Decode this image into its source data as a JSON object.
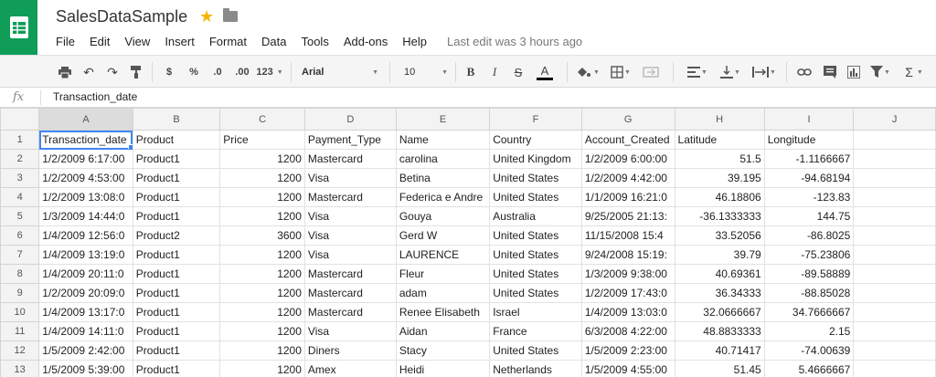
{
  "app": {
    "doc_title": "SalesDataSample",
    "menu": [
      "File",
      "Edit",
      "View",
      "Insert",
      "Format",
      "Data",
      "Tools",
      "Add-ons",
      "Help"
    ],
    "last_edit": "Last edit was 3 hours ago"
  },
  "toolbar": {
    "currency": "$",
    "percent": "%",
    "dec_decrease": ".0",
    "dec_increase": ".00",
    "more_formats": "123",
    "font": "Arial",
    "font_size": "10",
    "bold": "B",
    "italic": "I",
    "strike": "S",
    "text_color": "A",
    "sum": "Σ"
  },
  "formula_bar": {
    "fx": "fx",
    "content": "Transaction_date"
  },
  "sheet": {
    "columns": [
      "A",
      "B",
      "C",
      "D",
      "E",
      "F",
      "G",
      "H",
      "I",
      "J"
    ],
    "rows": [
      {
        "n": "1",
        "cells": [
          "Transaction_date",
          "Product",
          "Price",
          "Payment_Type",
          "Name",
          "Country",
          "Account_Created",
          "Latitude",
          "Longitude",
          ""
        ]
      },
      {
        "n": "2",
        "cells": [
          "1/2/2009 6:17:00",
          "Product1",
          "1200",
          "Mastercard",
          "carolina",
          "United Kingdom",
          "1/2/2009 6:00:00",
          "51.5",
          "-1.1166667",
          ""
        ]
      },
      {
        "n": "3",
        "cells": [
          "1/2/2009 4:53:00",
          "Product1",
          "1200",
          "Visa",
          "Betina",
          "United States",
          "1/2/2009 4:42:00",
          "39.195",
          "-94.68194",
          ""
        ]
      },
      {
        "n": "4",
        "cells": [
          "1/2/2009 13:08:0",
          "Product1",
          "1200",
          "Mastercard",
          "Federica e Andre",
          "United States",
          "1/1/2009 16:21:0",
          "46.18806",
          "-123.83",
          ""
        ]
      },
      {
        "n": "5",
        "cells": [
          "1/3/2009 14:44:0",
          "Product1",
          "1200",
          "Visa",
          "Gouya",
          "Australia",
          "9/25/2005 21:13:",
          "-36.1333333",
          "144.75",
          ""
        ]
      },
      {
        "n": "6",
        "cells": [
          "1/4/2009 12:56:0",
          "Product2",
          "3600",
          "Visa",
          "Gerd W",
          "United States",
          "11/15/2008 15:4",
          "33.52056",
          "-86.8025",
          ""
        ]
      },
      {
        "n": "7",
        "cells": [
          "1/4/2009 13:19:0",
          "Product1",
          "1200",
          "Visa",
          "LAURENCE",
          "United States",
          "9/24/2008 15:19:",
          "39.79",
          "-75.23806",
          ""
        ]
      },
      {
        "n": "8",
        "cells": [
          "1/4/2009 20:11:0",
          "Product1",
          "1200",
          "Mastercard",
          "Fleur",
          "United States",
          "1/3/2009 9:38:00",
          "40.69361",
          "-89.58889",
          ""
        ]
      },
      {
        "n": "9",
        "cells": [
          "1/2/2009 20:09:0",
          "Product1",
          "1200",
          "Mastercard",
          "adam",
          "United States",
          "1/2/2009 17:43:0",
          "36.34333",
          "-88.85028",
          ""
        ]
      },
      {
        "n": "10",
        "cells": [
          "1/4/2009 13:17:0",
          "Product1",
          "1200",
          "Mastercard",
          "Renee Elisabeth",
          "Israel",
          "1/4/2009 13:03:0",
          "32.0666667",
          "34.7666667",
          ""
        ]
      },
      {
        "n": "11",
        "cells": [
          "1/4/2009 14:11:0",
          "Product1",
          "1200",
          "Visa",
          "Aidan",
          "France",
          "6/3/2008 4:22:00",
          "48.8833333",
          "2.15",
          ""
        ]
      },
      {
        "n": "12",
        "cells": [
          "1/5/2009 2:42:00",
          "Product1",
          "1200",
          "Diners",
          "Stacy",
          "United States",
          "1/5/2009 2:23:00",
          "40.71417",
          "-74.00639",
          ""
        ]
      },
      {
        "n": "13",
        "cells": [
          "1/5/2009 5:39:00",
          "Product1",
          "1200",
          "Amex",
          "Heidi",
          "Netherlands",
          "1/5/2009 4:55:00",
          "51.45",
          "5.4666667",
          ""
        ]
      }
    ]
  },
  "colors": {
    "brand": "#0f9d58",
    "star": "#f4b400",
    "selection": "#4285f4"
  }
}
